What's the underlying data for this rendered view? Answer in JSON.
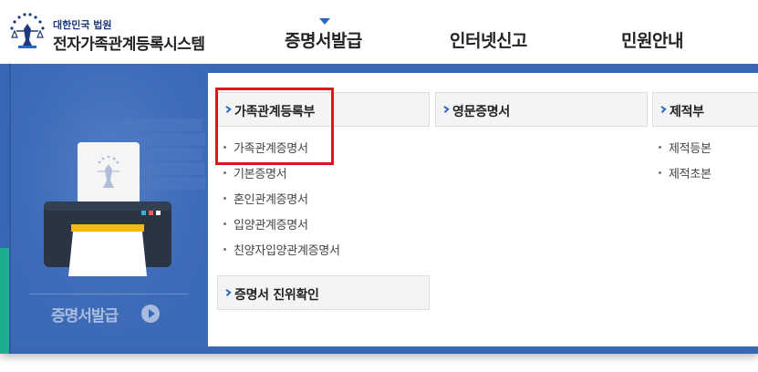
{
  "header": {
    "org_name": "대한민국 법원",
    "system_name": "전자가족관계등록시스템",
    "nav": [
      {
        "label": "증명서발급",
        "active": true
      },
      {
        "label": "인터넷신고",
        "active": false
      },
      {
        "label": "민원안내",
        "active": false
      }
    ]
  },
  "promo": {
    "label": "증명서발급",
    "icon": "play-circle-icon"
  },
  "menu": {
    "categories": {
      "family": {
        "title": "가족관계등록부",
        "items": [
          "가족관계증명서",
          "기본증명서",
          "혼인관계증명서",
          "입양관계증명서",
          "친양자입양관계증명서"
        ]
      },
      "english": {
        "title": "영문증명서",
        "items": []
      },
      "removed": {
        "title": "제적부",
        "items": [
          "제적등본",
          "제적초본"
        ]
      },
      "verify": {
        "title": "증명서 진위확인",
        "items": []
      }
    }
  },
  "colors": {
    "brand_blue": "#3a67b3",
    "accent_blue": "#2b67c6",
    "highlight_red": "#e8101a",
    "teal": "#1cae8f"
  }
}
